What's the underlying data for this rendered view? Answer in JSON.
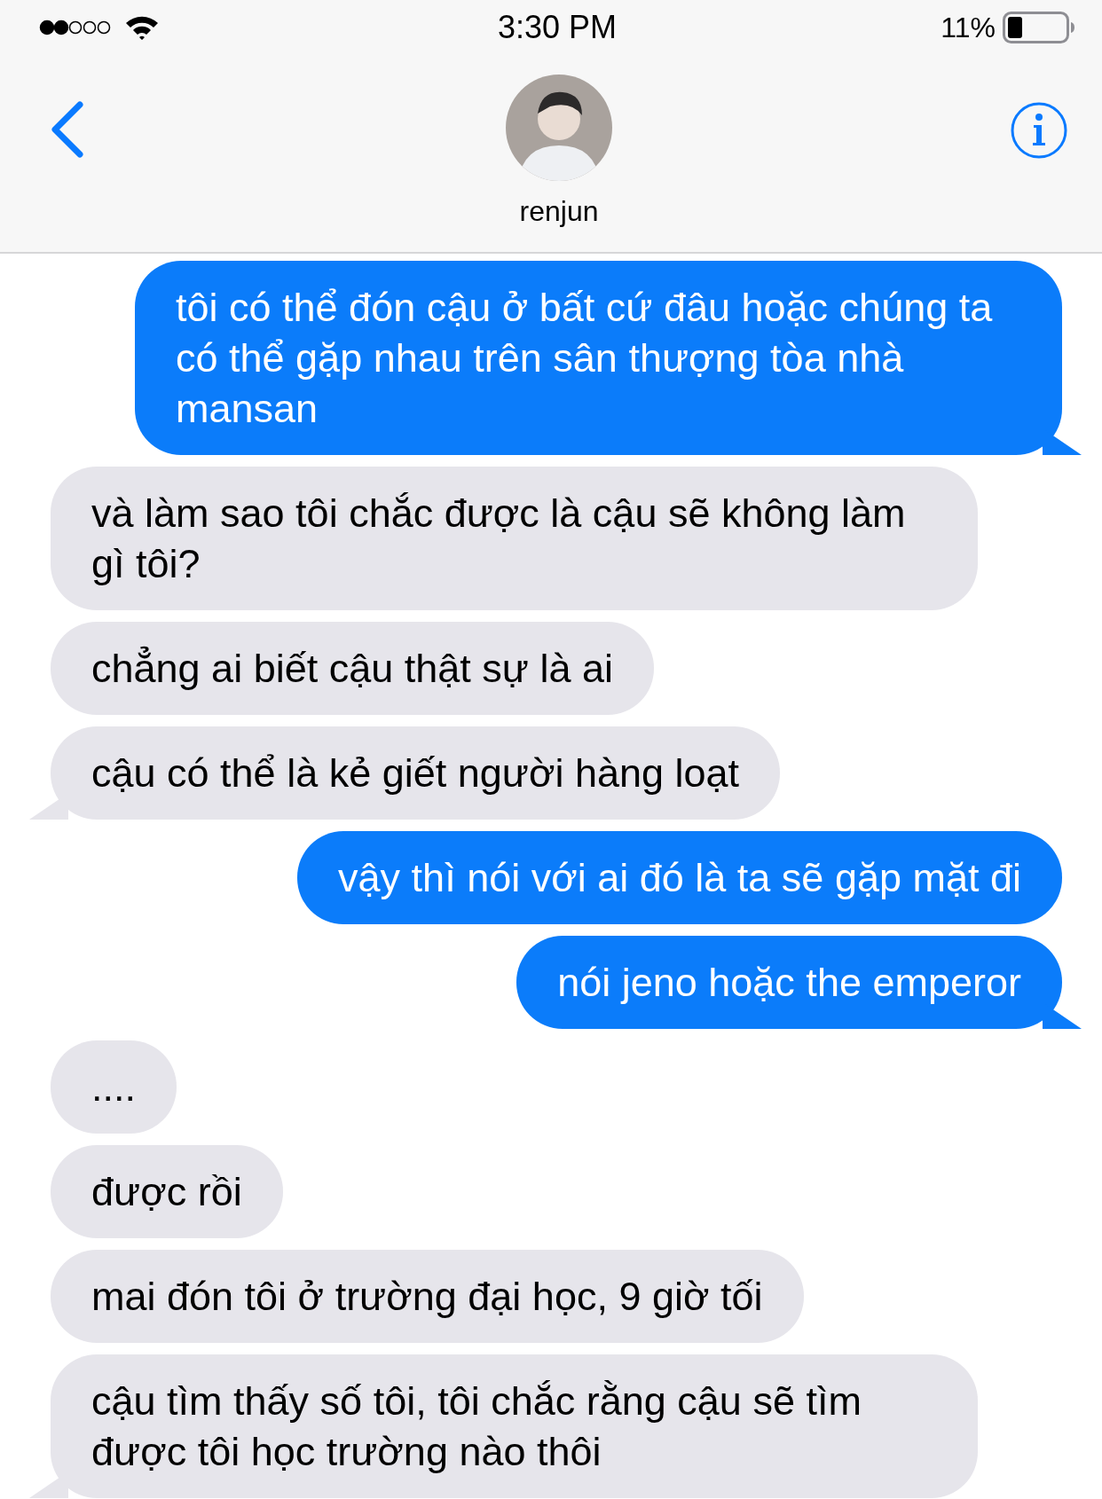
{
  "status_bar": {
    "time": "3:30 PM",
    "battery": "11%"
  },
  "header": {
    "contact_name": "renjun"
  },
  "messages": [
    {
      "kind": "sent",
      "text": "tôi có thể đón cậu ở bất cứ đâu hoặc chúng ta có thể gặp nhau trên sân thượng tòa nhà mansan",
      "tail": true
    },
    {
      "kind": "received",
      "text": "và làm sao tôi chắc được là cậu sẽ không làm gì tôi?",
      "tail": false
    },
    {
      "kind": "received",
      "text": "chẳng ai biết cậu thật sự là ai",
      "tail": false
    },
    {
      "kind": "received",
      "text": "cậu có thể là kẻ giết người hàng loạt",
      "tail": true
    },
    {
      "kind": "sent",
      "text": "vậy thì nói với ai đó là ta sẽ gặp mặt đi",
      "tail": false
    },
    {
      "kind": "sent",
      "text": "nói jeno hoặc the emperor",
      "tail": true
    },
    {
      "kind": "received",
      "text": "....",
      "tail": false
    },
    {
      "kind": "received",
      "text": "được rồi",
      "tail": false
    },
    {
      "kind": "received",
      "text": "mai đón tôi ở trường đại học, 9 giờ tối",
      "tail": false
    },
    {
      "kind": "received",
      "text": "cậu tìm thấy số tôi, tôi chắc rằng cậu sẽ tìm được tôi học trường nào thôi",
      "tail": true
    }
  ]
}
